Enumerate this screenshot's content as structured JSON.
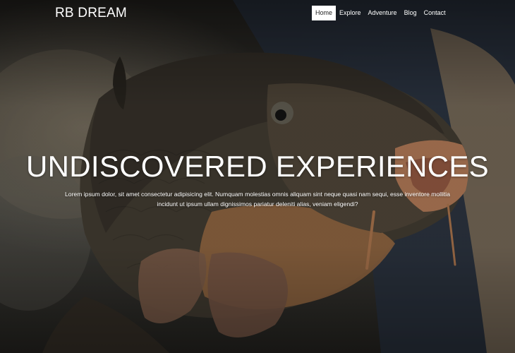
{
  "brand": {
    "name": "RB DREAM"
  },
  "nav": {
    "items": [
      "Home",
      "Explore",
      "Adventure",
      "Blog",
      "Contact"
    ],
    "active": "Home"
  },
  "hero": {
    "title": "UNDISCOVERED EXPERIENCES",
    "text": "Lorem ipsum dolor, sit amet consectetur adipisicing elit. Numquam molestias omnis aliquam sint neque quasi nam sequi, esse inventore mollitia incidunt ut ipsum ullam dignissimos pariatur deleniti alias, veniam eligendi?"
  },
  "colors": {
    "text": "#ffffff",
    "active_nav_bg": "#ffffff",
    "active_nav_text": "#222222"
  }
}
